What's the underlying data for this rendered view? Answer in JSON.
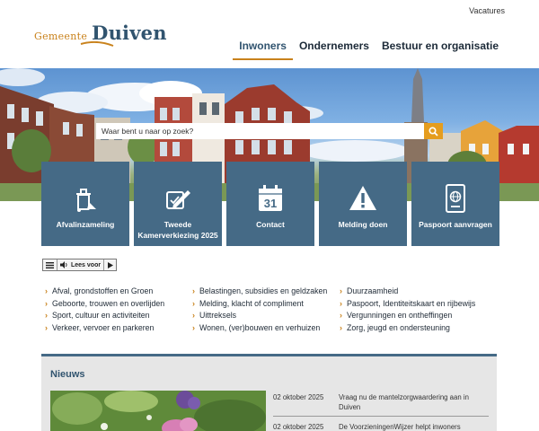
{
  "header": {
    "util_link": "Vacatures",
    "logo_small": "Gemeente",
    "logo_big": "Duiven",
    "nav": [
      "Inwoners",
      "Ondernemers",
      "Bestuur en organisatie"
    ]
  },
  "search": {
    "placeholder": "Waar bent u naar op zoek?",
    "icon": "search-icon"
  },
  "tiles": [
    {
      "label": "Afvalinzameling",
      "icon": "waste-bin-icon"
    },
    {
      "label": "Tweede Kamerverkiezing 2025",
      "icon": "ballot-pencil-icon"
    },
    {
      "label": "Contact",
      "icon": "calendar-31-icon",
      "icon_text": "31"
    },
    {
      "label": "Melding doen",
      "icon": "warning-icon"
    },
    {
      "label": "Paspoort aanvragen",
      "icon": "passport-icon"
    }
  ],
  "readspeaker": {
    "label": "Lees voor"
  },
  "links": {
    "col1": [
      "Afval, grondstoffen en Groen",
      "Geboorte, trouwen en overlijden",
      "Sport, cultuur en activiteiten",
      "Verkeer, vervoer en parkeren"
    ],
    "col2": [
      "Belastingen, subsidies en geldzaken",
      "Melding, klacht of compliment",
      "Uittreksels",
      "Wonen, (ver)bouwen en verhuizen"
    ],
    "col3": [
      "Duurzaamheid",
      "Paspoort, Identiteitskaart en rijbewijs",
      "Vergunningen en ontheffingen",
      "Zorg, jeugd en ondersteuning"
    ]
  },
  "news": {
    "title": "Nieuws",
    "items": [
      {
        "date": "02 oktober 2025",
        "text": "Vraag nu de mantelzorgwaardering aan in Duiven"
      },
      {
        "date": "02 oktober 2025",
        "text": "De VoorzieningenWijzer helpt inwoners"
      }
    ]
  },
  "colors": {
    "brand_blue": "#456a86",
    "accent_orange": "#c9821c",
    "search_orange": "#e59d1e"
  }
}
